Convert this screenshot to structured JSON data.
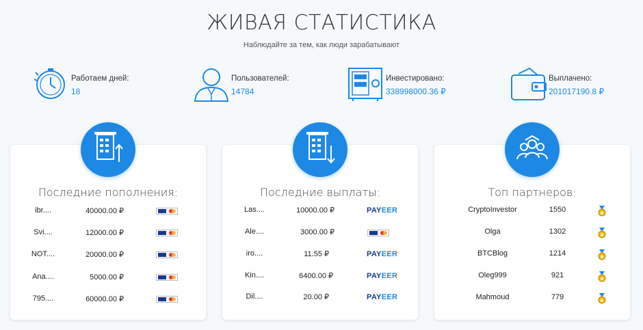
{
  "header": {
    "title": "ЖИВАЯ СТАТИСТИКА",
    "subtitle": "Наблюдайте за тем, как люди зарабатывают"
  },
  "stats": [
    {
      "label": "Работаем дней:",
      "value": "18",
      "icon": "stopwatch-icon"
    },
    {
      "label": "Пользователей:",
      "value": "14784",
      "icon": "user-icon"
    },
    {
      "label": "Инвестировано:",
      "value": "338998000.36 ₽",
      "icon": "safe-icon"
    },
    {
      "label": "Выплачено:",
      "value": "201017190.8 ₽",
      "icon": "wallet-icon"
    }
  ],
  "deposits": {
    "title": "Последние пополнения:",
    "icon": "card-arrow-up-icon",
    "rows": [
      {
        "name": "ibr....",
        "amount": "40000.00 ₽",
        "method": "visa-mastercard"
      },
      {
        "name": "Svi....",
        "amount": "12000.00 ₽",
        "method": "visa-mastercard"
      },
      {
        "name": "NOT....",
        "amount": "20000.00 ₽",
        "method": "visa-mastercard"
      },
      {
        "name": "Ana....",
        "amount": "5000.00 ₽",
        "method": "visa-mastercard"
      },
      {
        "name": "795....",
        "amount": "60000.00 ₽",
        "method": "visa-mastercard"
      }
    ]
  },
  "payouts": {
    "title": "Последние выплаты:",
    "icon": "card-arrow-down-icon",
    "rows": [
      {
        "name": "Las....",
        "amount": "10000.00 ₽",
        "method": "payeer"
      },
      {
        "name": "Ale....",
        "amount": "3000.00 ₽",
        "method": "visa-mastercard"
      },
      {
        "name": "iro....",
        "amount": "11.55 ₽",
        "method": "payeer"
      },
      {
        "name": "Kin....",
        "amount": "6400.00 ₽",
        "method": "payeer"
      },
      {
        "name": "Dil....",
        "amount": "20.00 ₽",
        "method": "payeer"
      }
    ]
  },
  "partners": {
    "title": "Топ партнеров:",
    "icon": "team-icon",
    "rows": [
      {
        "name": "CryptoInvestor",
        "count": "1550"
      },
      {
        "name": "Olga",
        "count": "1302"
      },
      {
        "name": "BTCBlog",
        "count": "1214"
      },
      {
        "name": "Oleg999",
        "count": "921"
      },
      {
        "name": "Mahmoud",
        "count": "779"
      }
    ]
  },
  "payeer_logo": {
    "pay": "PAY",
    "eer": "EER"
  },
  "colors": {
    "accent": "#1e88e5",
    "background": "#f6f9fc"
  }
}
